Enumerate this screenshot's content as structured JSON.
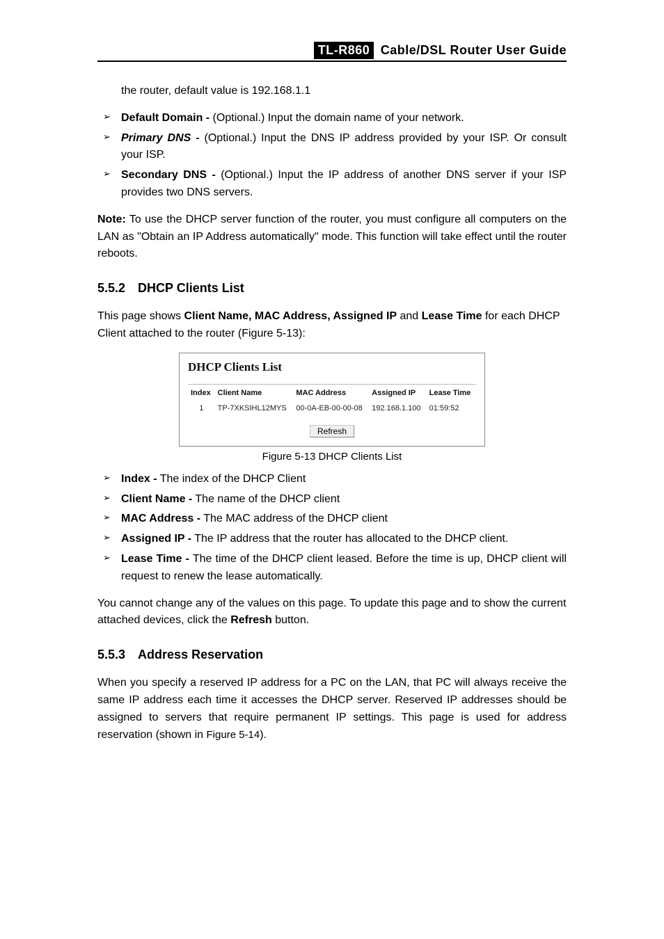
{
  "header": {
    "model": "TL-R860",
    "title_rest": "Cable/DSL  Router  User  Guide"
  },
  "top_continuation": "the router, default value is 192.168.1.1",
  "bullets_top": [
    {
      "label": "Default Domain -",
      "text": " (Optional.) Input the domain name of your network."
    },
    {
      "label": "Primary DNS -",
      "text": " (Optional.) Input the DNS IP address provided by your ISP. Or consult your ISP."
    },
    {
      "label": "Secondary DNS -",
      "text": " (Optional.) Input the IP address of another DNS server if your ISP provides two DNS servers."
    }
  ],
  "note": {
    "label": "Note:",
    "text": " To use the DHCP server function of the router, you must configure all computers on the LAN as \"Obtain an IP Address automatically\" mode. This function will take effect until the router reboots."
  },
  "section_552": {
    "num": "5.5.2",
    "title": "DHCP Clients List",
    "intro_pre": "This page shows ",
    "intro_bold": "Client Name, MAC Address, Assigned IP",
    "intro_mid": " and ",
    "intro_bold2": "Lease Time",
    "intro_post": " for each DHCP Client attached to the router (Figure 5-13):"
  },
  "figure": {
    "title": "DHCP Clients List",
    "headers": {
      "c1": "Index",
      "c2": "Client Name",
      "c3": "MAC Address",
      "c4": "Assigned IP",
      "c5": "Lease Time"
    },
    "row": {
      "c1": "1",
      "c2": "TP-7XKSIHL12MYS",
      "c3": "00-0A-EB-00-00-08",
      "c4": "192.168.1.100",
      "c5": "01:59:52"
    },
    "refresh": "Refresh",
    "caption": "Figure 5-13 DHCP Clients List"
  },
  "bullets_fields": [
    {
      "label": "Index -",
      "text": " The index of the DHCP Client"
    },
    {
      "label": "Client Name -",
      "text": " The name of the DHCP client"
    },
    {
      "label": "MAC Address -",
      "text": " The MAC address of the DHCP client"
    },
    {
      "label": "Assigned IP -",
      "text": " The IP address that the router has allocated to the DHCP client."
    },
    {
      "label": "Lease Time -",
      "text": " The time of the DHCP client leased. Before the time is up, DHCP client will request to renew the lease automatically."
    }
  ],
  "para_after": {
    "pre": "You cannot change any of the values on this page. To update this page and to show the current attached devices, click the ",
    "bold": "Refresh",
    "post": " button."
  },
  "section_553": {
    "num": "5.5.3",
    "title": "Address Reservation",
    "body_pre": "When you specify a reserved IP address for a PC on the LAN, that PC will always receive the same IP address each time it accesses the DHCP server. Reserved IP addresses should be assigned to servers that require permanent IP settings. This page is used for address reservation (shown in ",
    "body_ref": "Figure 5-14",
    "body_post": ")."
  }
}
